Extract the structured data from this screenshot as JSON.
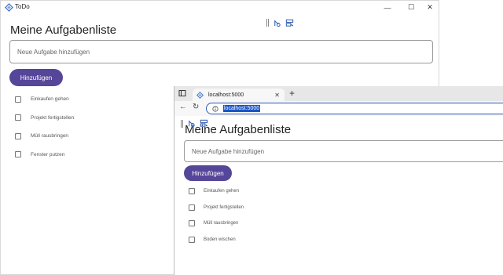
{
  "app_window": {
    "title": "ToDo",
    "window_controls": {
      "minimize": "—",
      "maximize": "☐",
      "close": "✕"
    },
    "heading": "Meine Aufgabenliste",
    "input_placeholder": "Neue Aufgabe hinzufügen",
    "add_button": "Hinzufügen",
    "todos": [
      "Einkaufen gehen",
      "Projekt fertigstellen",
      "Müll rausbringen",
      "Fenster putzen"
    ]
  },
  "browser": {
    "tab_title": "localhost:5000",
    "tab_close": "✕",
    "new_tab": "+",
    "back": "←",
    "reload": "↻",
    "url": "localhost:5000",
    "heading": "Meine Aufgabenliste",
    "input_placeholder": "Neue Aufgabe hinzufügen",
    "add_button": "Hinzufügen",
    "todos": [
      "Einkaufen gehen",
      "Projekt fertigstellen",
      "Müll rausbringen",
      "Boden wischen"
    ]
  },
  "colors": {
    "accent": "#56469a",
    "url_highlight": "#1a55c7",
    "focus_border": "#2a59b8"
  },
  "icons": [
    "app-logo-icon",
    "tab-actions-icon",
    "favicon-icon",
    "info-icon",
    "devtools-grip-icon",
    "devtools-inspect-icon",
    "devtools-layout-icon"
  ]
}
